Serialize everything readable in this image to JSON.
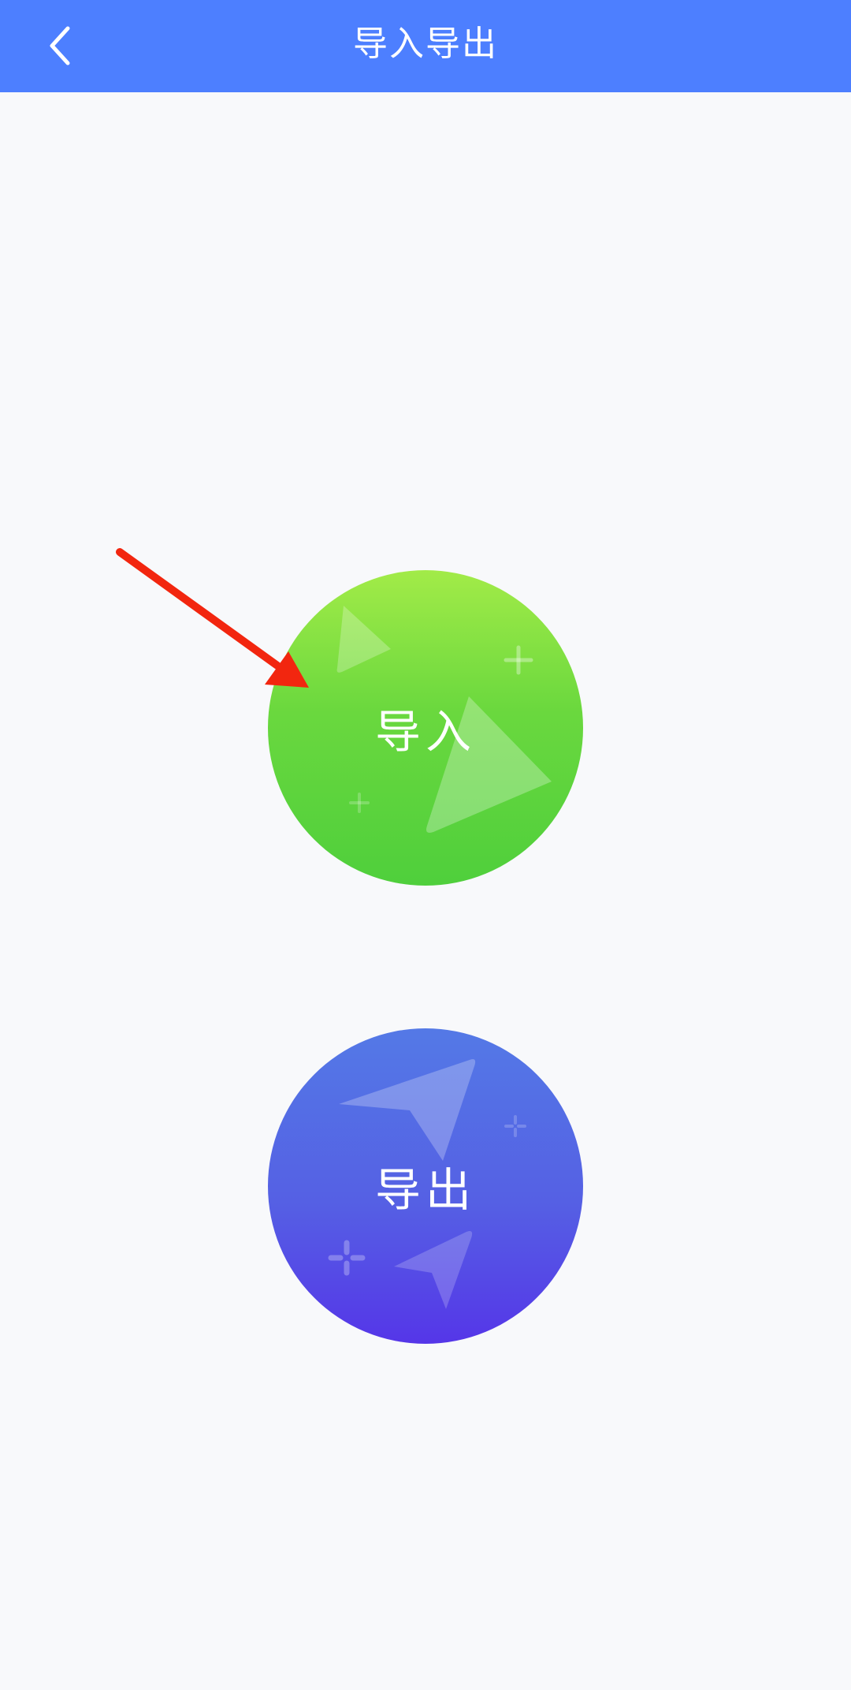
{
  "header": {
    "title": "导入导出",
    "back_icon": "chevron-left-icon",
    "background": "#4d7fff"
  },
  "actions": {
    "import_label": "导入",
    "export_label": "导出",
    "import_color": "#5ccf3c",
    "export_color": "#5547e6"
  },
  "annotation": {
    "arrow_icon": "red-pointer-arrow",
    "arrow_color": "#f2260f"
  }
}
